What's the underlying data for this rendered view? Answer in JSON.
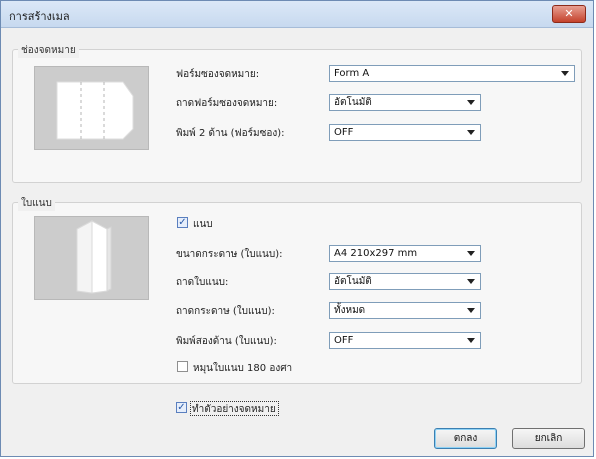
{
  "window": {
    "title": "การสร้างเมล",
    "close_glyph": "✕"
  },
  "envelope": {
    "group_label": "ช่องจดหมาย",
    "fields": [
      {
        "label": "ฟอร์มซองจดหมาย:",
        "value": "Form A"
      },
      {
        "label": "ถาดฟอร์มซองจดหมาย:",
        "value": "อัตโนมัติ"
      },
      {
        "label": "พิมพ์ 2 ด้าน (ฟอร์มซอง):",
        "value": "OFF"
      }
    ]
  },
  "insert": {
    "group_label": "ใบแนบ",
    "attach": {
      "label": "แนบ",
      "checked": true
    },
    "fields": [
      {
        "label": "ขนาดกระดาษ (ใบแนบ):",
        "value": "A4 210x297 mm"
      },
      {
        "label": "ถาดใบแนบ:",
        "value": "อัตโนมัติ"
      },
      {
        "label": "ถาดกระดาษ (ใบแนบ):",
        "value": "ทั้งหมด"
      },
      {
        "label": "พิมพ์สองด้าน (ใบแนบ):",
        "value": "OFF"
      }
    ],
    "rotate": {
      "label": "หมุนใบแนบ 180 องศา",
      "checked": false
    }
  },
  "sample": {
    "label": "ทำตัวอย่างจดหมาย",
    "checked": true
  },
  "buttons": {
    "ok": "ตกลง",
    "cancel": "ยกเลิก"
  },
  "colors": {
    "titlebar": "#c7d9ef",
    "close": "#c4422c",
    "preview_bg": "#cccccc",
    "accent": "#3c7fb1"
  }
}
